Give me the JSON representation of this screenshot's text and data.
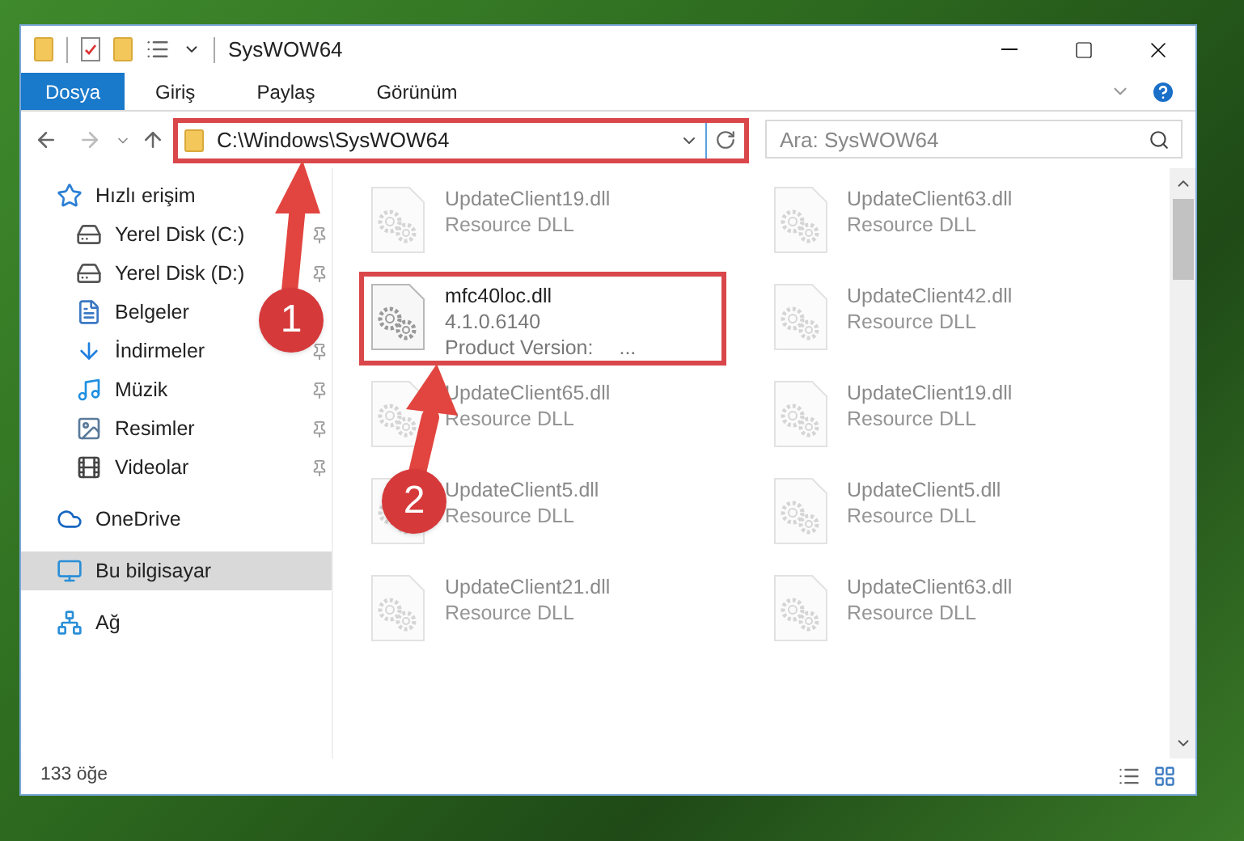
{
  "window": {
    "title": "SysWOW64"
  },
  "ribbon_tabs": [
    {
      "label": "Dosya",
      "selected": true
    },
    {
      "label": "Giriş",
      "selected": false
    },
    {
      "label": "Paylaş",
      "selected": false
    },
    {
      "label": "Görünüm",
      "selected": false
    }
  ],
  "address": {
    "path": "C:\\Windows\\SysWOW64"
  },
  "search": {
    "placeholder": "Ara: SysWOW64"
  },
  "nav": [
    {
      "label": "Hızlı erişim",
      "kind": "star",
      "selected": false,
      "children": [
        {
          "label": "Yerel Disk (C:)",
          "kind": "system-drive",
          "pinned": true,
          "selected": false
        },
        {
          "label": "Yerel Disk (D:)",
          "kind": "drive",
          "pinned": true,
          "selected": false
        },
        {
          "label": "Belgeler",
          "kind": "documents",
          "pinned": false,
          "selected": false
        },
        {
          "label": "İndirmeler",
          "kind": "downloads",
          "pinned": true,
          "selected": false
        },
        {
          "label": "Müzik",
          "kind": "music",
          "pinned": true,
          "selected": false
        },
        {
          "label": "Resimler",
          "kind": "pictures",
          "pinned": true,
          "selected": false
        },
        {
          "label": "Videolar",
          "kind": "videos",
          "pinned": true,
          "selected": false
        }
      ]
    },
    {
      "label": "OneDrive",
      "kind": "cloud",
      "selected": false
    },
    {
      "label": "Bu bilgisayar",
      "kind": "computer",
      "selected": true
    },
    {
      "label": "Ağ",
      "kind": "network",
      "selected": false
    }
  ],
  "files": [
    {
      "name": "UpdateClient19.dll",
      "detail": "Resource DLL",
      "faded": true,
      "highlighted": false
    },
    {
      "name": "UpdateClient63.dll",
      "detail": "Resource DLL",
      "faded": true,
      "highlighted": false
    },
    {
      "name": "mfc40loc.dll",
      "detail": "4.1.0.6140",
      "extra_label": "Product Version:",
      "extra_value": "...",
      "faded": false,
      "highlighted": true
    },
    {
      "name": "UpdateClient42.dll",
      "detail": "Resource DLL",
      "faded": true,
      "highlighted": false
    },
    {
      "name": "UpdateClient65.dll",
      "detail": "Resource DLL",
      "faded": true,
      "highlighted": false
    },
    {
      "name": "UpdateClient19.dll",
      "detail": "Resource DLL",
      "faded": true,
      "highlighted": false
    },
    {
      "name": "UpdateClient5.dll",
      "detail": "Resource DLL",
      "faded": true,
      "highlighted": false
    },
    {
      "name": "UpdateClient5.dll",
      "detail": "Resource DLL",
      "faded": true,
      "highlighted": false
    },
    {
      "name": "UpdateClient21.dll",
      "detail": "Resource DLL",
      "faded": true,
      "highlighted": false
    },
    {
      "name": "UpdateClient63.dll",
      "detail": "Resource DLL",
      "faded": true,
      "highlighted": false
    }
  ],
  "status_bar": {
    "count": "133 öğe"
  },
  "annotations": [
    {
      "label": "1"
    },
    {
      "label": "2"
    }
  ]
}
